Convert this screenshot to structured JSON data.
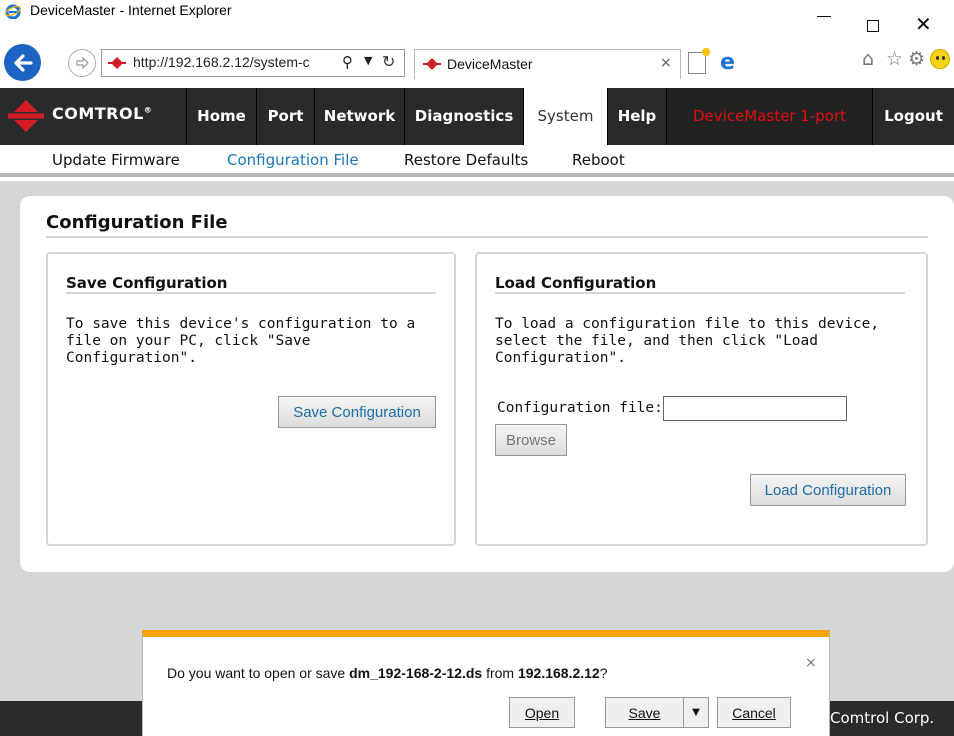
{
  "window": {
    "title": "DeviceMaster - Internet Explorer",
    "icon": "ie-icon"
  },
  "browser": {
    "url": "http://192.168.2.12/system-c",
    "tab_title": "DeviceMaster",
    "tab_close": "×",
    "icons": [
      "back-icon",
      "forward-icon",
      "search-icon",
      "refresh-icon",
      "new-tab-icon",
      "edge-icon",
      "home-icon",
      "favorites-icon",
      "settings-icon",
      "smiley-icon"
    ]
  },
  "nav": {
    "brand": "Comtrol",
    "items": [
      "Home",
      "Port",
      "Network",
      "Diagnostics",
      "System",
      "Help"
    ],
    "active": "System",
    "device_name": "DeviceMaster 1-port",
    "logout": "Logout"
  },
  "subnav": {
    "items": [
      "Update Firmware",
      "Configuration File",
      "Restore Defaults",
      "Reboot"
    ],
    "active": "Configuration File"
  },
  "page": {
    "title": "Configuration File",
    "save": {
      "heading": "Save Configuration",
      "desc": "To save this device's configuration to a\nfile on your PC, click \"Save\nConfiguration\".",
      "button": "Save Configuration"
    },
    "load": {
      "heading": "Load Configuration",
      "desc": "To load a configuration file to this device,\nselect the file, and then click \"Load\nConfiguration\".",
      "file_label": "Configuration file:",
      "file_value": "",
      "browse": "Browse",
      "button": "Load Configuration"
    }
  },
  "footer": {
    "copyright": "Comtrol Corp."
  },
  "download_bar": {
    "prefix": "Do you want to open or save ",
    "filename": "dm_192-168-2-12.ds",
    "middle": " from ",
    "host": "192.168.2.12",
    "suffix": "?",
    "open": "Open",
    "save": "Save",
    "cancel": "Cancel",
    "close": "×"
  },
  "colors": {
    "accent_link": "#1b77b4",
    "nav_bg": "#2a2a2a",
    "device_name": "#e10e0e",
    "download_bar_accent": "#f2a500"
  }
}
